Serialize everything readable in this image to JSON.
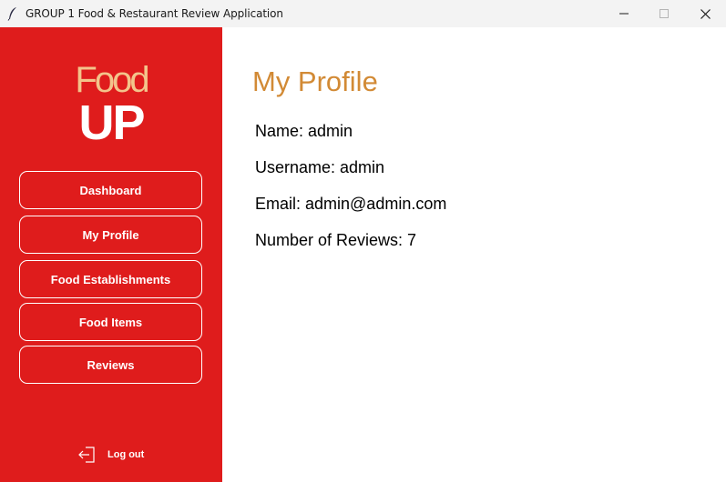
{
  "window": {
    "title": "GROUP 1 Food & Restaurant Review Application",
    "app_icon": "feather-icon"
  },
  "sidebar": {
    "logo": {
      "top": "Food",
      "bottom": "UP"
    },
    "items": [
      {
        "label": "Dashboard"
      },
      {
        "label": "My Profile"
      },
      {
        "label": "Food Establishments"
      },
      {
        "label": "Food Items"
      },
      {
        "label": "Reviews"
      }
    ],
    "logout": {
      "label": "Log out",
      "icon": "logout-icon"
    }
  },
  "main": {
    "title": "My Profile",
    "fields": {
      "name": "Name: admin",
      "username": "Username: admin",
      "email": "Email: admin@admin.com",
      "reviews": "Number of Reviews: 7"
    }
  },
  "colors": {
    "sidebar_bg": "#df1c1c",
    "logo_accent": "#f3c48b",
    "title_accent": "#d28a35"
  }
}
